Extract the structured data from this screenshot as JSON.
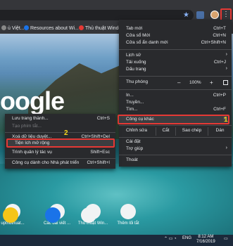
{
  "bookmarks": [
    {
      "label": "ủ Việt...",
      "color": "#888888"
    },
    {
      "label": "Resources about Wi...",
      "color": "#1a73e8"
    },
    {
      "label": "Thủ thuật Windo",
      "color": "#e53935"
    }
  ],
  "google_text": "oogle",
  "main_menu": {
    "items": [
      {
        "label": "Tab mới",
        "shortcut": "Ctrl+T"
      },
      {
        "label": "Cửa sổ Mới",
        "shortcut": "Ctrl+N"
      },
      {
        "label": "Cửa sổ ẩn danh mới",
        "shortcut": "Ctrl+Shift+N"
      },
      {
        "label": "Lịch sử",
        "arrow": "›"
      },
      {
        "label": "Tải xuống",
        "shortcut": "Ctrl+J"
      },
      {
        "label": "Dấu trang",
        "arrow": "›"
      },
      {
        "label": "In...",
        "shortcut": "Ctrl+P"
      },
      {
        "label": "Truyền...",
        "shortcut": ""
      },
      {
        "label": "Tìm...",
        "shortcut": "Ctrl+F"
      },
      {
        "label": "Công cụ khác",
        "arrow": "›"
      },
      {
        "label": "Cài đặt"
      },
      {
        "label": "Trợ giúp",
        "arrow": "›"
      },
      {
        "label": "Thoát"
      }
    ],
    "zoom": {
      "label": "Thu phóng",
      "minus": "–",
      "value": "100%",
      "plus": "+"
    },
    "edit": {
      "label": "Chỉnh sửa",
      "cut": "Cắt",
      "copy": "Sao chép",
      "paste": "Dán"
    }
  },
  "submenu": {
    "items": [
      {
        "label": "Lưu trang thành...",
        "shortcut": "Ctrl+S"
      },
      {
        "label": "Tạo phím tắt...",
        "shortcut": ""
      },
      {
        "label": "Xoá dữ liệu duyệt...",
        "shortcut": "Ctrl+Shift+Del"
      },
      {
        "label": "Tiện ích mở rộng",
        "shortcut": ""
      },
      {
        "label": "Trình quản lý tác vụ",
        "shortcut": "Shift+Esc"
      },
      {
        "label": "Công cụ dành cho Nhà phát triển",
        "shortcut": "Ctrl+Shift+I"
      }
    ]
  },
  "badges": {
    "one": "1",
    "two": "2"
  },
  "shortcuts_row1": [
    {
      "label": "upthuthuat..."
    },
    {
      "label": "Các bài viết ..."
    },
    {
      "label": "Thủ thuật Win..."
    },
    {
      "label": "Thêm lối tắt"
    }
  ],
  "shortcuts_row2": [
    {
      "label": ""
    },
    {
      "label": ""
    },
    {
      "label": ""
    }
  ],
  "taskbar": {
    "lang": "ENG",
    "time": "8:12 AM",
    "date": "7/16/2019"
  }
}
